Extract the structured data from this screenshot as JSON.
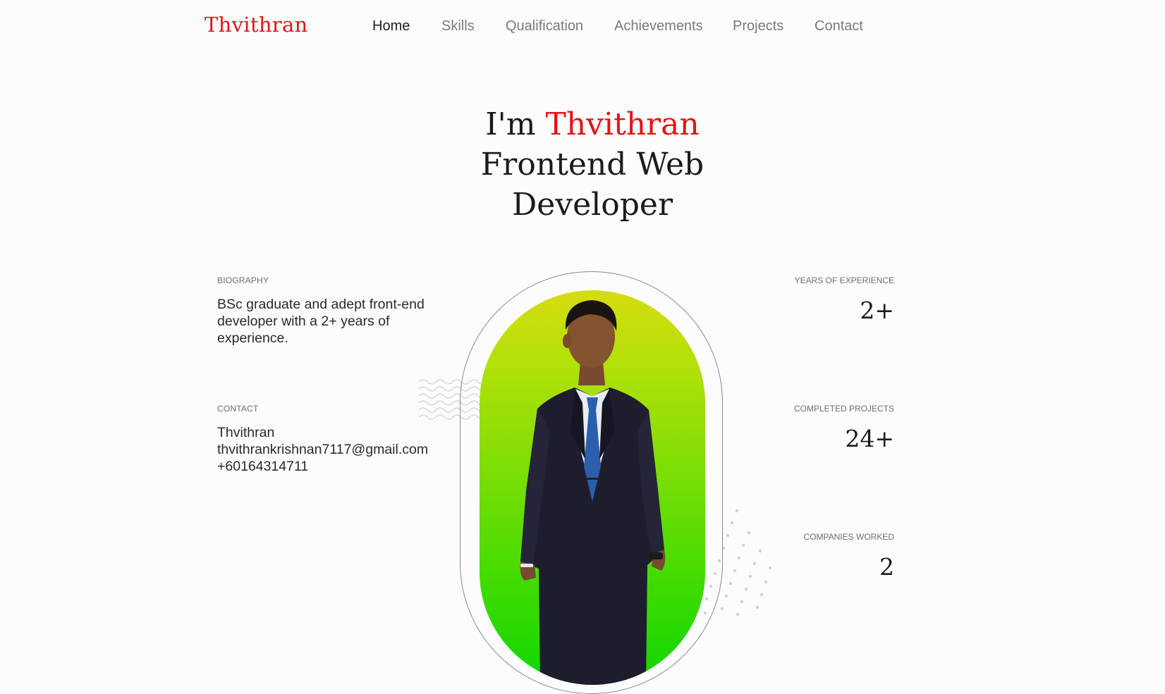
{
  "header": {
    "logo": "Thvithran",
    "nav": [
      {
        "label": "Home",
        "active": true
      },
      {
        "label": "Skills",
        "active": false
      },
      {
        "label": "Qualification",
        "active": false
      },
      {
        "label": "Achievements",
        "active": false
      },
      {
        "label": "Projects",
        "active": false
      },
      {
        "label": "Contact",
        "active": false
      }
    ]
  },
  "hero": {
    "prefix": "I'm",
    "name": "Thvithran",
    "line2": "Frontend Web",
    "line3": "Developer"
  },
  "biography": {
    "label": "BIOGRAPHY",
    "text": "BSc graduate and adept front-end developer with a 2+ years of experience."
  },
  "contact": {
    "label": "CONTACT",
    "name": "Thvithran",
    "email": "thvithrankrishnan7117@gmail.com",
    "phone": "+60164314711"
  },
  "stats": [
    {
      "label": "YEARS OF EXPERIENCE",
      "value": "2+"
    },
    {
      "label": "COMPLETED PROJECTS",
      "value": "24+"
    },
    {
      "label": "COMPANIES WORKED",
      "value": "2"
    }
  ],
  "colors": {
    "accent": "#e31414",
    "photo_gradient_top": "#d6dc0f",
    "photo_gradient_bottom": "#10d600"
  }
}
